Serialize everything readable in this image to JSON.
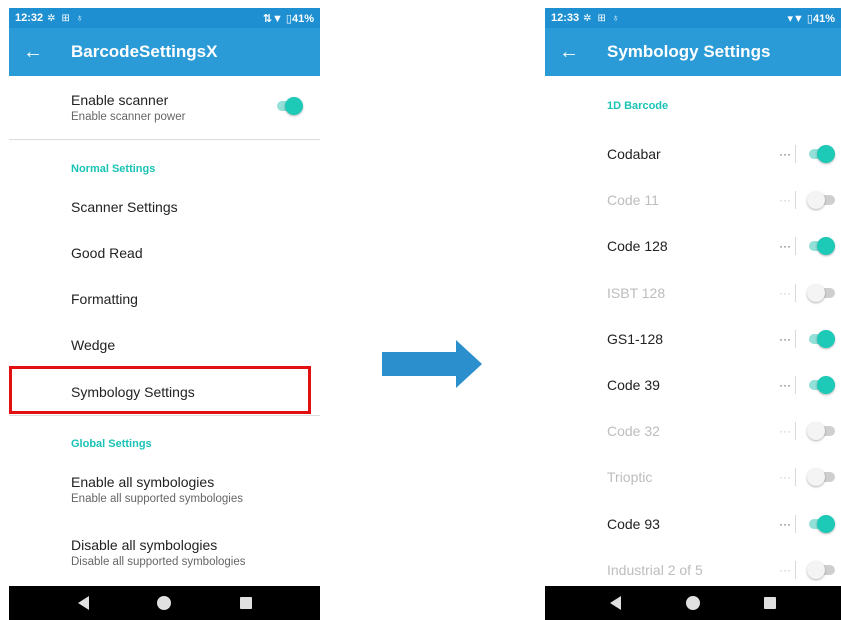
{
  "left": {
    "status": {
      "time": "12:32",
      "icons": [
        "settings-icon",
        "scanner-icon",
        "usb-icon"
      ],
      "right": "⇅▼ ▯41%"
    },
    "appbar": {
      "title": "BarcodeSettingsX"
    },
    "enable_scanner": {
      "title": "Enable scanner",
      "subtitle": "Enable scanner power",
      "on": true
    },
    "normal_header": "Normal Settings",
    "normal_items": [
      "Scanner Settings",
      "Good Read",
      "Formatting",
      "Wedge",
      "Symbology Settings"
    ],
    "global_header": "Global Settings",
    "global_items": [
      {
        "title": "Enable all symbologies",
        "subtitle": "Enable all supported symbologies"
      },
      {
        "title": "Disable all symbologies",
        "subtitle": "Disable all supported symbologies"
      }
    ]
  },
  "right": {
    "status": {
      "time": "12:33",
      "icons": [
        "settings-icon",
        "scanner-icon",
        "usb-icon"
      ],
      "right": "▾▼ ▯41%"
    },
    "appbar": {
      "title": "Symbology Settings"
    },
    "section_header": "1D Barcode",
    "symbologies": [
      {
        "name": "Codabar",
        "enabled": true
      },
      {
        "name": "Code 11",
        "enabled": false
      },
      {
        "name": "Code 128",
        "enabled": true
      },
      {
        "name": "ISBT 128",
        "enabled": false
      },
      {
        "name": "GS1-128",
        "enabled": true
      },
      {
        "name": "Code 39",
        "enabled": true
      },
      {
        "name": "Code 32",
        "enabled": false
      },
      {
        "name": "Trioptic",
        "enabled": false
      },
      {
        "name": "Code 93",
        "enabled": true
      },
      {
        "name": "Industrial 2 of 5",
        "enabled": false
      }
    ],
    "more_label": "···"
  },
  "colors": {
    "appbar": "#2b9bd8",
    "statusbar": "#1e8fd1",
    "accent": "#1dc9b7",
    "highlight": "#e21010",
    "arrow": "#2a8fcc"
  }
}
